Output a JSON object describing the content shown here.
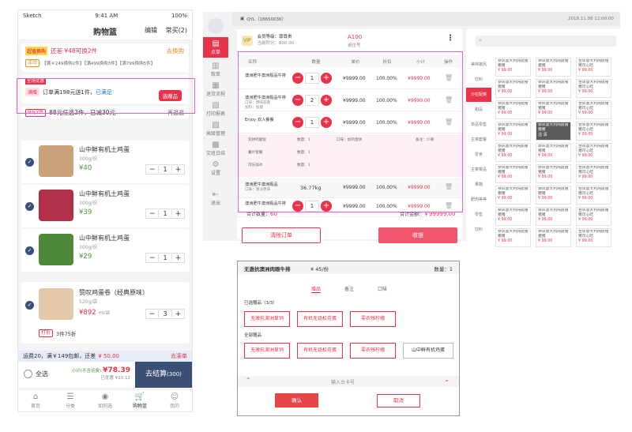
{
  "phone": {
    "status": {
      "carrier": "Sketch",
      "time": "9:41 AM",
      "battery": "100%"
    },
    "nav": {
      "title": "购物篮",
      "edit": "编辑",
      "store": "常买(2)"
    },
    "promo1": {
      "badge": "超值换购",
      "text": "还差 ¥48可换2件",
      "link": "去换购",
      "tag": "活动",
      "tiers": "【满￥249换购2件】【满499换购3件】【满799换购5件】"
    },
    "promo2": {
      "badge": "全场优惠",
      "tag": "满赠",
      "text": "订单满198元送1件，",
      "met": "已满足",
      "btn": "选赠品"
    },
    "promo3": {
      "tag": "N元Y件",
      "text": "88元任选3件，已减30元",
      "link": "再逛逛"
    },
    "items": [
      {
        "name": "山中鲜有机土鸡蛋",
        "spec": "300g/份",
        "price": "¥40",
        "qty": "1",
        "color": "#c9a27a"
      },
      {
        "name": "山中鲜有机土鸡蛋",
        "spec": "300g/份",
        "price": "¥39",
        "qty": "1",
        "color": "#b03048"
      },
      {
        "name": "山中鲜有机土鸡蛋",
        "spec": "300g/份",
        "price": "¥29",
        "qty": "1",
        "color": "#4f8a3a"
      },
      {
        "name": "赞叹鸡蛋卷（经典原味）",
        "spec": "520g/袋",
        "price": "¥892",
        "price_unit": "¥9/袋",
        "qty": "3",
        "color": "#e3c9a8",
        "deal_tag": "打折",
        "deal": "3件75折"
      }
    ],
    "shipping": {
      "text": "运费20，满￥149包邮，还差",
      "amount": "¥ 50.00",
      "link": "去凑单"
    },
    "footer": {
      "select_all": "全选",
      "subtotal_label": "小计(不含运费)",
      "subtotal": "¥78.39",
      "saved": "已优惠 ¥10.12",
      "checkout": "去结算",
      "count": "(300)"
    },
    "tabs": [
      "首页",
      "分类",
      "如何选",
      "购物篮",
      "我的"
    ]
  },
  "pos": {
    "side": [
      "点单",
      "取单",
      "退货流程",
      "打印报表",
      "高级管理",
      "交班日结",
      "设置",
      "退出"
    ],
    "user": "QYL（18650036）",
    "vip": {
      "badge": "VIP",
      "level": "会员等级：",
      "level_val": "尊尊贵",
      "points": "当前积分：800.00",
      "code": "A100",
      "code_label": "桌位号"
    },
    "datetime": "2018.11.08 12:00:00",
    "headers": [
      "名称",
      "数量",
      "单价",
      "折扣",
      "小计",
      "操作"
    ],
    "rows": [
      {
        "name": "澳洲肥牛澳洲极品牛排",
        "sub": "",
        "qty": "1",
        "price": "¥9999.00",
        "disc": "100.00%",
        "total": "¥9999.00"
      },
      {
        "name": "澳洲肥牛澳洲极品牛排",
        "sub": "口味：原味蒜蓉",
        "sub2": "加料：加蛋",
        "qty": "2",
        "price": "¥9999.00",
        "disc": "100.00%",
        "total": "¥9999.00"
      },
      {
        "name": "Enjoy 双人餐餐",
        "sub": "",
        "qty": "1",
        "price": "¥9999.00",
        "disc": "100.00%",
        "total": "¥9999.00"
      },
      {
        "name": "澳洲肥牛澳洲极品",
        "sub": "口味：清淡原味",
        "qty": "36.77kg",
        "price": "¥9999.00",
        "disc": "100.00%",
        "total": "¥9999.00"
      },
      {
        "name": "澳洲肥牛澳洲极品牛排",
        "sub": "",
        "qty": "1",
        "price": "¥9999.00",
        "disc": "100.00%",
        "total": "¥9999.00"
      }
    ],
    "combo": [
      {
        "a": "双拼鸡腿饭",
        "b": "数量：1",
        "c": "口味：加鸡蛋拼",
        "d": "备注：少辣"
      },
      {
        "a": "薯片套餐",
        "b": "数量：1",
        "c": "",
        "d": ""
      },
      {
        "a": "可乐加冰",
        "b": "数量：1",
        "c": "",
        "d": ""
      }
    ],
    "sum_count_label": "合计数量：",
    "sum_count": "60",
    "sum_total_label": "合计金额：",
    "sum_total": "￥99999.00",
    "clear": "清除订单",
    "pay": "收银",
    "cats": [
      "美味披风",
      "饮料",
      "沙拉配菜",
      "甜品",
      "单品零售",
      "主菜套餐",
      "零食",
      "主菜菜品",
      "果蔬",
      "肥肉等等",
      "零售",
      "饮料"
    ],
    "grid_name": "恭风意大利炖饭猪猪猪",
    "grid_name2": "合凤意大利炖饭猪猪可心吃",
    "grid_price": "¥ 99.00",
    "soldout": "沽 清"
  },
  "modal": {
    "title": "无激抗澳洲肉眼牛排",
    "price": "¥ 45/份",
    "count": "数量：1",
    "tabs": [
      "赠品",
      "备注",
      "口味"
    ],
    "selected_label": "已选赠品（3/3）",
    "selected": [
      "无激抗澳洲草饲",
      "有机无铅松花蛋",
      "零农残柠檬"
    ],
    "all_label": "全部赠品",
    "all": [
      "无激抗澳洲草饲",
      "有机无铅松花蛋",
      "零农残柠檬",
      "山中鲜有机鸡蛋"
    ],
    "input_placeholder": "输入台卡号",
    "confirm": "确认",
    "cancel": "取消"
  }
}
